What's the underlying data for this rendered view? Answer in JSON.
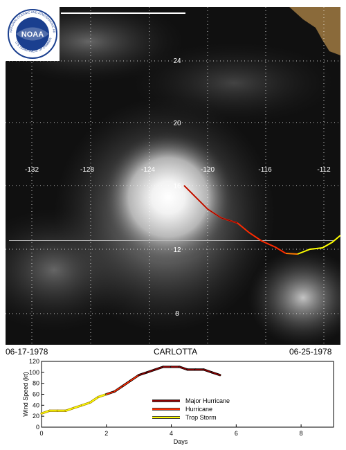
{
  "storm": {
    "name": "CARLOTTA",
    "start_date": "06-17-1978",
    "end_date": "06-25-1978"
  },
  "logo": {
    "text": "NOAA",
    "ring_text_top": "NATIONAL OCEANIC AND ATMOSPHERIC ADMINISTRATION",
    "ring_text_bottom": "U.S. DEPARTMENT OF COMMERCE"
  },
  "map": {
    "lon_labels": [
      "-132",
      "-128",
      "-124",
      "-120",
      "-116",
      "-112"
    ],
    "lat_labels": [
      "24",
      "20",
      "16",
      "12",
      "8"
    ]
  },
  "colors": {
    "major_hurricane": "#8b0000",
    "hurricane": "#ff2a00",
    "trop_storm": "#ffff00",
    "grid": "#ffffff"
  },
  "chart_data": {
    "type": "line",
    "title": "",
    "xlabel": "Days",
    "ylabel": "Wind Speed (kt)",
    "xlim": [
      0,
      9
    ],
    "ylim": [
      0,
      120
    ],
    "x_ticks": [
      "0",
      "2",
      "4",
      "6",
      "8"
    ],
    "y_ticks": [
      "0",
      "20",
      "40",
      "60",
      "80",
      "100",
      "120"
    ],
    "legend": {
      "position": "center-bottom",
      "entries": [
        {
          "name": "Major Hurricane",
          "color": "#8b0000"
        },
        {
          "name": "Hurricane",
          "color": "#ff2a00"
        },
        {
          "name": "Trop Storm",
          "color": "#ffff00"
        }
      ]
    },
    "series": [
      {
        "x": [
          0,
          0.25,
          0.5,
          0.75,
          1.0,
          1.25,
          1.5,
          1.75,
          2.0,
          2.25,
          2.5,
          2.75,
          3.0,
          3.25,
          3.5,
          3.75,
          4.0,
          4.25,
          4.5,
          4.75,
          5.0,
          5.25,
          5.5
        ],
        "y": [
          25,
          30,
          30,
          30,
          35,
          40,
          45,
          55,
          60,
          65,
          75,
          85,
          95,
          100,
          105,
          110,
          110,
          110,
          105,
          105,
          105,
          100,
          95
        ]
      }
    ]
  }
}
